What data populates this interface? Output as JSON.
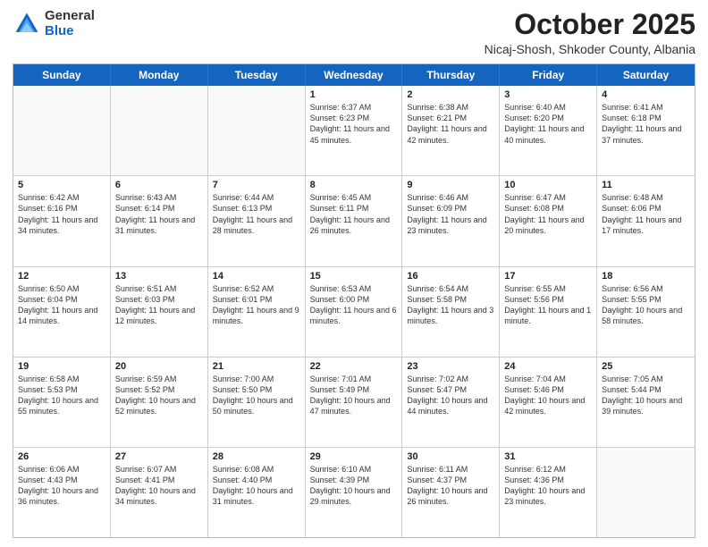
{
  "header": {
    "logo": {
      "general": "General",
      "blue": "Blue"
    },
    "title": "October 2025",
    "location": "Nicaj-Shosh, Shkoder County, Albania"
  },
  "calendar": {
    "days": [
      "Sunday",
      "Monday",
      "Tuesday",
      "Wednesday",
      "Thursday",
      "Friday",
      "Saturday"
    ],
    "weeks": [
      [
        {
          "day": "",
          "text": ""
        },
        {
          "day": "",
          "text": ""
        },
        {
          "day": "",
          "text": ""
        },
        {
          "day": "1",
          "text": "Sunrise: 6:37 AM\nSunset: 6:23 PM\nDaylight: 11 hours and 45 minutes."
        },
        {
          "day": "2",
          "text": "Sunrise: 6:38 AM\nSunset: 6:21 PM\nDaylight: 11 hours and 42 minutes."
        },
        {
          "day": "3",
          "text": "Sunrise: 6:40 AM\nSunset: 6:20 PM\nDaylight: 11 hours and 40 minutes."
        },
        {
          "day": "4",
          "text": "Sunrise: 6:41 AM\nSunset: 6:18 PM\nDaylight: 11 hours and 37 minutes."
        }
      ],
      [
        {
          "day": "5",
          "text": "Sunrise: 6:42 AM\nSunset: 6:16 PM\nDaylight: 11 hours and 34 minutes."
        },
        {
          "day": "6",
          "text": "Sunrise: 6:43 AM\nSunset: 6:14 PM\nDaylight: 11 hours and 31 minutes."
        },
        {
          "day": "7",
          "text": "Sunrise: 6:44 AM\nSunset: 6:13 PM\nDaylight: 11 hours and 28 minutes."
        },
        {
          "day": "8",
          "text": "Sunrise: 6:45 AM\nSunset: 6:11 PM\nDaylight: 11 hours and 26 minutes."
        },
        {
          "day": "9",
          "text": "Sunrise: 6:46 AM\nSunset: 6:09 PM\nDaylight: 11 hours and 23 minutes."
        },
        {
          "day": "10",
          "text": "Sunrise: 6:47 AM\nSunset: 6:08 PM\nDaylight: 11 hours and 20 minutes."
        },
        {
          "day": "11",
          "text": "Sunrise: 6:48 AM\nSunset: 6:06 PM\nDaylight: 11 hours and 17 minutes."
        }
      ],
      [
        {
          "day": "12",
          "text": "Sunrise: 6:50 AM\nSunset: 6:04 PM\nDaylight: 11 hours and 14 minutes."
        },
        {
          "day": "13",
          "text": "Sunrise: 6:51 AM\nSunset: 6:03 PM\nDaylight: 11 hours and 12 minutes."
        },
        {
          "day": "14",
          "text": "Sunrise: 6:52 AM\nSunset: 6:01 PM\nDaylight: 11 hours and 9 minutes."
        },
        {
          "day": "15",
          "text": "Sunrise: 6:53 AM\nSunset: 6:00 PM\nDaylight: 11 hours and 6 minutes."
        },
        {
          "day": "16",
          "text": "Sunrise: 6:54 AM\nSunset: 5:58 PM\nDaylight: 11 hours and 3 minutes."
        },
        {
          "day": "17",
          "text": "Sunrise: 6:55 AM\nSunset: 5:56 PM\nDaylight: 11 hours and 1 minute."
        },
        {
          "day": "18",
          "text": "Sunrise: 6:56 AM\nSunset: 5:55 PM\nDaylight: 10 hours and 58 minutes."
        }
      ],
      [
        {
          "day": "19",
          "text": "Sunrise: 6:58 AM\nSunset: 5:53 PM\nDaylight: 10 hours and 55 minutes."
        },
        {
          "day": "20",
          "text": "Sunrise: 6:59 AM\nSunset: 5:52 PM\nDaylight: 10 hours and 52 minutes."
        },
        {
          "day": "21",
          "text": "Sunrise: 7:00 AM\nSunset: 5:50 PM\nDaylight: 10 hours and 50 minutes."
        },
        {
          "day": "22",
          "text": "Sunrise: 7:01 AM\nSunset: 5:49 PM\nDaylight: 10 hours and 47 minutes."
        },
        {
          "day": "23",
          "text": "Sunrise: 7:02 AM\nSunset: 5:47 PM\nDaylight: 10 hours and 44 minutes."
        },
        {
          "day": "24",
          "text": "Sunrise: 7:04 AM\nSunset: 5:46 PM\nDaylight: 10 hours and 42 minutes."
        },
        {
          "day": "25",
          "text": "Sunrise: 7:05 AM\nSunset: 5:44 PM\nDaylight: 10 hours and 39 minutes."
        }
      ],
      [
        {
          "day": "26",
          "text": "Sunrise: 6:06 AM\nSunset: 4:43 PM\nDaylight: 10 hours and 36 minutes."
        },
        {
          "day": "27",
          "text": "Sunrise: 6:07 AM\nSunset: 4:41 PM\nDaylight: 10 hours and 34 minutes."
        },
        {
          "day": "28",
          "text": "Sunrise: 6:08 AM\nSunset: 4:40 PM\nDaylight: 10 hours and 31 minutes."
        },
        {
          "day": "29",
          "text": "Sunrise: 6:10 AM\nSunset: 4:39 PM\nDaylight: 10 hours and 29 minutes."
        },
        {
          "day": "30",
          "text": "Sunrise: 6:11 AM\nSunset: 4:37 PM\nDaylight: 10 hours and 26 minutes."
        },
        {
          "day": "31",
          "text": "Sunrise: 6:12 AM\nSunset: 4:36 PM\nDaylight: 10 hours and 23 minutes."
        },
        {
          "day": "",
          "text": ""
        }
      ]
    ]
  }
}
